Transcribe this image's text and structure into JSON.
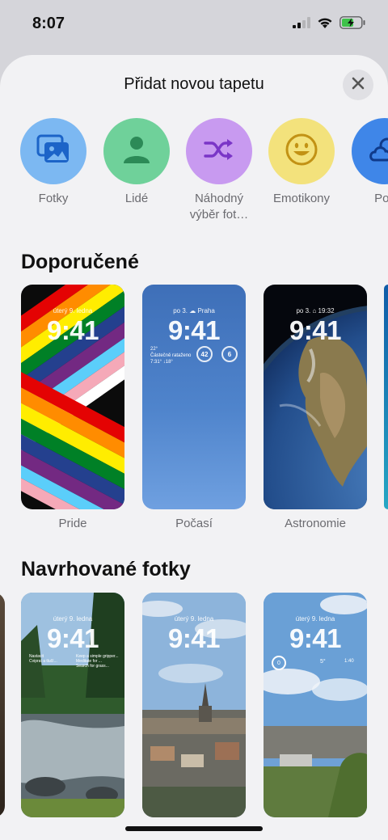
{
  "status": {
    "time": "8:07",
    "icons": [
      "signal-icon",
      "wifi-icon",
      "battery-charging-icon"
    ]
  },
  "sheet": {
    "title": "Přidat novou tapetu",
    "close_icon": "close-icon"
  },
  "categories": [
    {
      "label": "Fotky",
      "icon": "photos-icon",
      "color": "#7cb8f2"
    },
    {
      "label": "Lidé",
      "icon": "person-icon",
      "color": "#6fd19a"
    },
    {
      "label": "Náhodný výběr fot…",
      "icon": "shuffle-icon",
      "color": "#c89af0"
    },
    {
      "label": "Emotikony",
      "icon": "emoji-icon",
      "color": "#f3e27c"
    },
    {
      "label": "Poč",
      "icon": "weather-icon",
      "color": "#3f86e8"
    }
  ],
  "recommended": {
    "title": "Doporučené",
    "items": [
      {
        "label": "Pride",
        "date": "úterý 9. ledna",
        "time": "9:41"
      },
      {
        "label": "Počasí",
        "date": "po 3. ☁ Praha",
        "time": "9:41",
        "weather_temp": "22°",
        "weather_text": "Částečně rataženo",
        "weather_sub": "7:31° ↓18°",
        "gauge1": "42",
        "gauge2": "6"
      },
      {
        "label": "Astronomie",
        "date": "po 3. ⌂ 19:32",
        "time": "9:41"
      }
    ]
  },
  "suggested": {
    "title": "Navrhované fotky",
    "items": [
      {
        "date": "úterý 9. ledna",
        "time": "9:41",
        "note1": "Nastavit",
        "note2": "Cviprat a tlučí...",
        "note3": "Keep a simple gripper...",
        "note4": "Meditate for ...",
        "note5": "Search for grass..."
      },
      {
        "date": "úterý 9. ledna",
        "time": "9:41"
      },
      {
        "date": "úterý 9. ledna",
        "time": "9:41",
        "w1": "5°",
        "w2": "0",
        "w3": "1:40"
      }
    ]
  }
}
